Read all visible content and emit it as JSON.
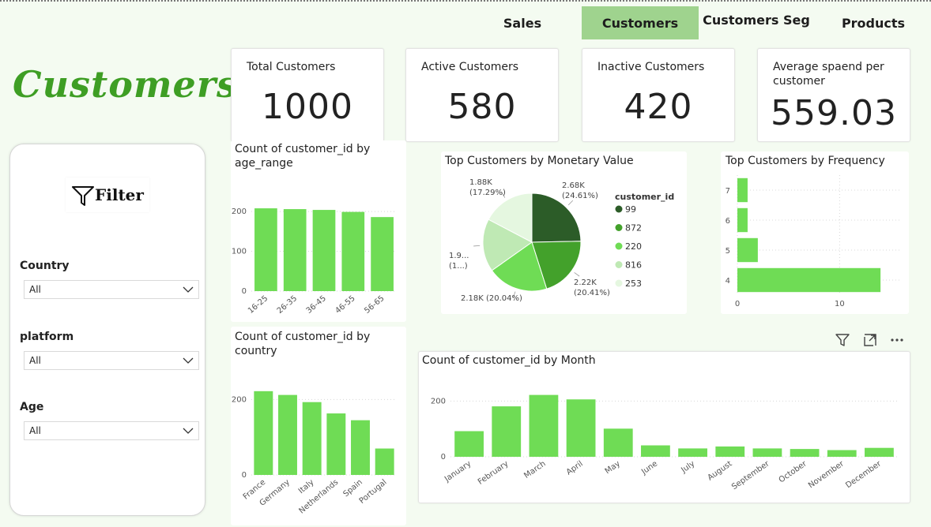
{
  "nav": {
    "tabs": [
      {
        "label": "Sales"
      },
      {
        "label": "Customers"
      },
      {
        "label": "Customers Seg"
      },
      {
        "label": "Products"
      }
    ]
  },
  "page_title": "Customers",
  "kpis": [
    {
      "label": "Total Customers",
      "value": "1000"
    },
    {
      "label": "Active Customers",
      "value": "580"
    },
    {
      "label": "Inactive Customers",
      "value": "420"
    },
    {
      "label": "Average spaend per customer",
      "value": "559.03"
    }
  ],
  "filter": {
    "title": "Filter",
    "slicers": [
      {
        "title": "Country",
        "value": "All"
      },
      {
        "title": "platform",
        "value": "All"
      },
      {
        "title": "Age",
        "value": "All"
      }
    ]
  },
  "colors": {
    "bar": "#6fdc55",
    "accent": "#3e9e24",
    "nav_active": "#9fd38e"
  },
  "visual_icons": [
    "filter-icon",
    "focus-mode-icon",
    "more-options-icon"
  ],
  "chart_data": [
    {
      "id": "age",
      "type": "bar",
      "title": "Count of customer_id by age_range",
      "categories": [
        "16-25",
        "26-35",
        "36-45",
        "46-55",
        "56-65"
      ],
      "values": [
        208,
        206,
        204,
        199,
        186
      ],
      "ylim": [
        0,
        220
      ],
      "yticks": [
        0,
        100,
        200
      ]
    },
    {
      "id": "country",
      "type": "bar",
      "title": "Count of customer_id by country",
      "categories": [
        "France",
        "Germany",
        "Italy",
        "Netherlands",
        "Spain",
        "Portugal"
      ],
      "values": [
        222,
        212,
        193,
        163,
        145,
        70
      ],
      "ylim": [
        0,
        230
      ],
      "yticks": [
        0,
        200
      ]
    },
    {
      "id": "monetary",
      "type": "pie",
      "title": "Top Customers by Monetary Value",
      "legend_title": "customer_id",
      "slices": [
        {
          "name": "99",
          "value": 2680,
          "label": "2.68K",
          "pct": "(24.61%)",
          "color": "#2c5c28"
        },
        {
          "name": "872",
          "value": 2220,
          "label": "2.22K",
          "pct": "(20.41%)",
          "color": "#43a12b"
        },
        {
          "name": "220",
          "value": 2180,
          "label": "2.18K (20.04%)",
          "pct": "",
          "color": "#6fdc55"
        },
        {
          "name": "816",
          "value": 1900,
          "label": "1.9...",
          "pct": "(1...)",
          "color": "#bfe9b4"
        },
        {
          "name": "253",
          "value": 1880,
          "label": "1.88K",
          "pct": "(17.29%)",
          "color": "#e5f7e0"
        }
      ]
    },
    {
      "id": "frequency",
      "type": "bar",
      "orientation": "horizontal",
      "title": "Top Customers by Frequency",
      "categories": [
        "7",
        "6",
        "5",
        "4"
      ],
      "values": [
        1,
        1,
        2,
        14
      ],
      "xlim": [
        0,
        16
      ],
      "xticks": [
        0,
        10
      ]
    },
    {
      "id": "month",
      "type": "bar",
      "title": "Count of customer_id by Month",
      "categories": [
        "January",
        "February",
        "March",
        "April",
        "May",
        "June",
        "July",
        "August",
        "September",
        "October",
        "November",
        "December"
      ],
      "values": [
        92,
        181,
        222,
        206,
        101,
        41,
        30,
        37,
        30,
        28,
        24,
        32
      ],
      "ylim": [
        0,
        235
      ],
      "yticks": [
        0,
        200
      ]
    }
  ]
}
